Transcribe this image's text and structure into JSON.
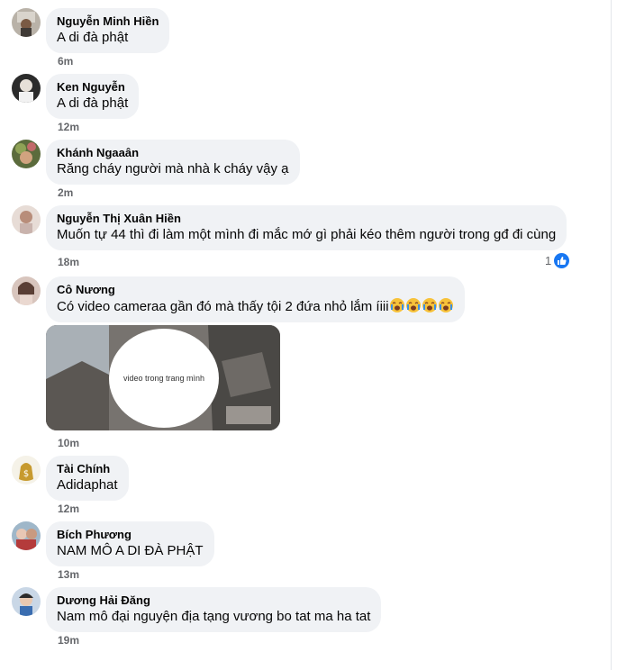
{
  "comments": [
    {
      "author": "Nguyễn Minh Hiền",
      "text": "A di đà phật",
      "time": "6m"
    },
    {
      "author": "Ken Nguyễn",
      "text": "A di đà phật",
      "time": "12m"
    },
    {
      "author": "Khánh Ngaaân",
      "text": "Răng cháy người mà nhà k cháy vậy ạ",
      "time": "2m"
    },
    {
      "author": "Nguyễn Thị Xuân Hiền",
      "text": "Muốn tự 44 thì đi làm một mình đi mắc mớ gì phải kéo thêm người trong gđ đi cùng",
      "time": "18m",
      "reactions": "1"
    },
    {
      "author": "Cô Nương",
      "text": "Có video cameraa gần đó mà thấy tội 2 đứa nhỏ lắm íiii",
      "time": "10m",
      "media_caption": "video trong trang mình"
    },
    {
      "author": "Tài Chính",
      "text": "Adidaphat",
      "time": "12m"
    },
    {
      "author": "Bích Phương",
      "text": "NAM MÔ A DI ĐÀ PHẬT",
      "time": "13m"
    },
    {
      "author": "Dương Hải Đăng",
      "text": "Nam mô đại nguyện địa tạng vương bo tat ma ha tat",
      "time": "19m"
    }
  ],
  "icons": {
    "like": "like-icon",
    "crying": "crying-emoji-icon"
  },
  "colors": {
    "bubble": "#f0f2f5",
    "like_blue": "#1877f2",
    "time_gray": "#65676b"
  }
}
